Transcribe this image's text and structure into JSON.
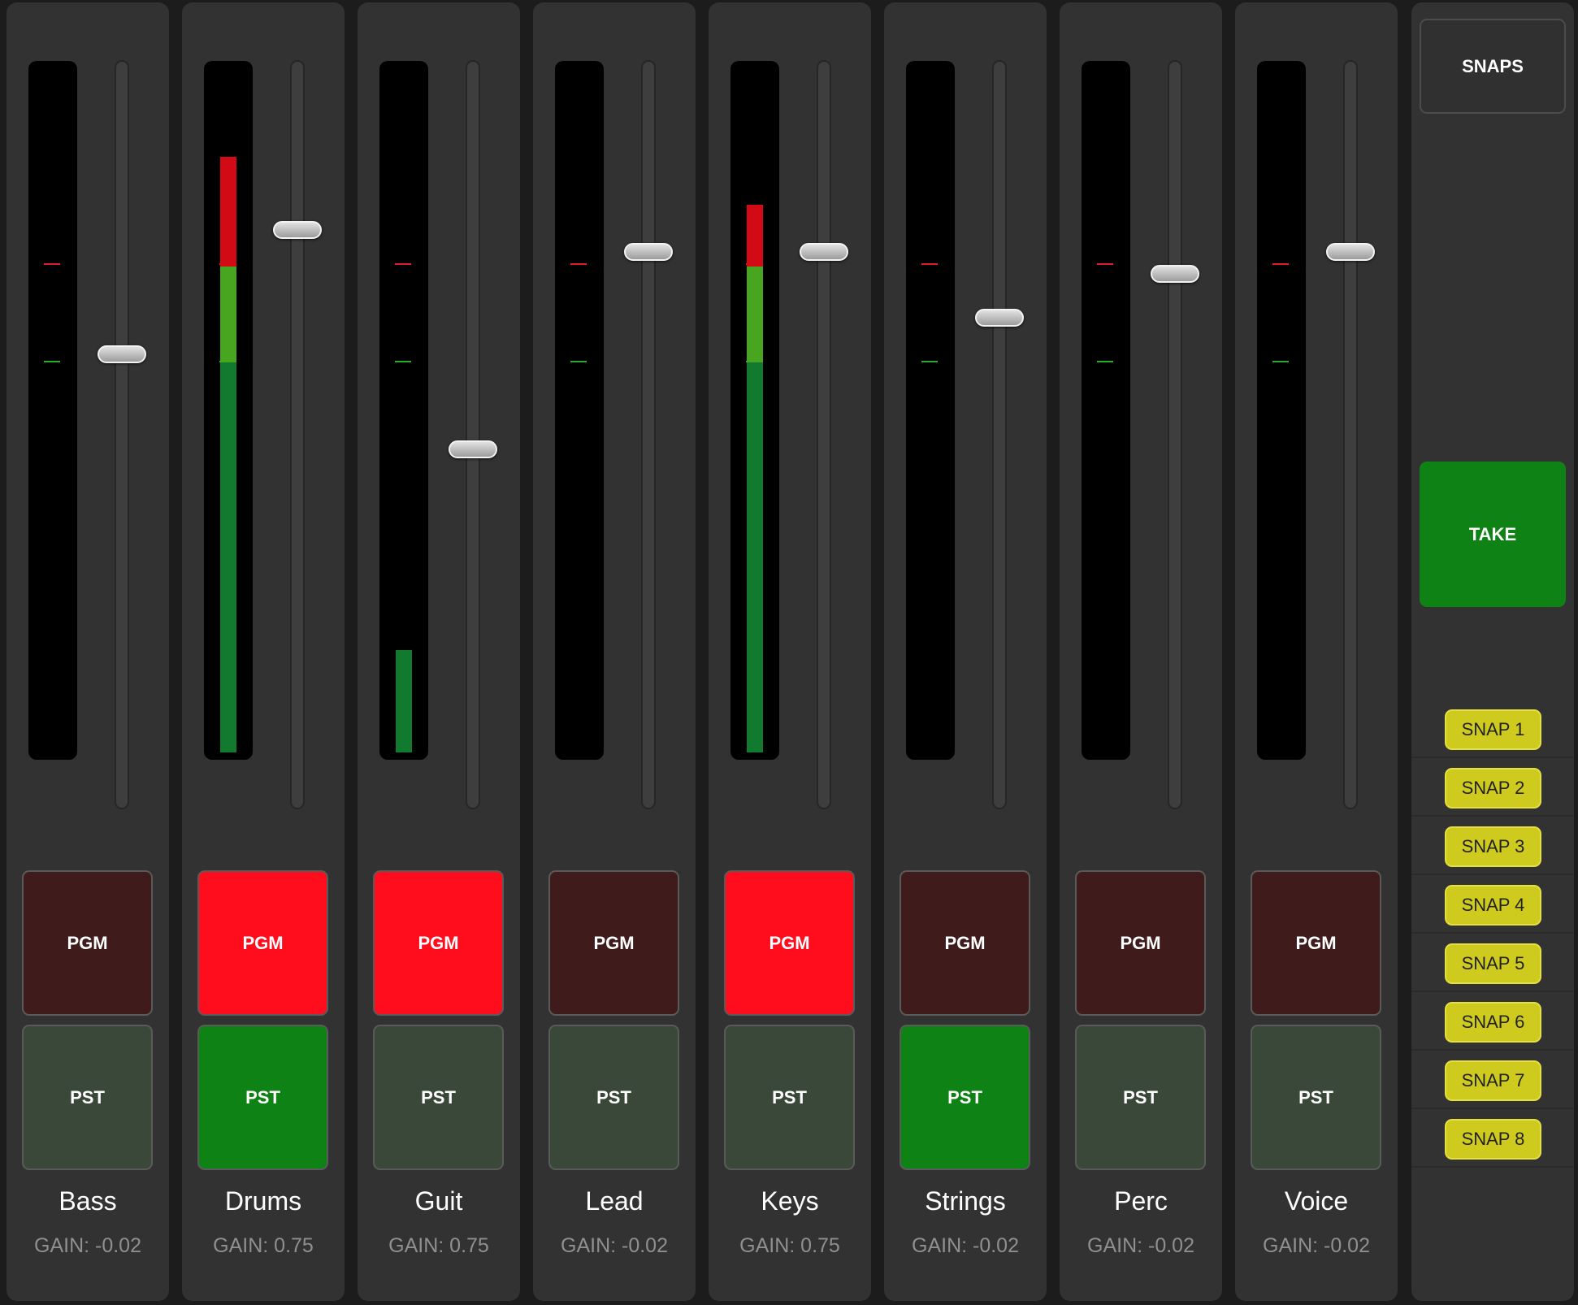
{
  "colors": {
    "pgm_on": "#ff0d1d",
    "pgm_off": "#3f1b1c",
    "pst_on": "#0f8215",
    "pst_off": "#394839",
    "meter_low": "#117a2e",
    "meter_mid": "#47a520",
    "meter_high": "#d20a16",
    "snap_button": "#cfcb1e",
    "take_button": "#0f8215"
  },
  "channels": [
    {
      "name": "Bass",
      "gain_text": "GAIN: -0.02",
      "pgm_label": "PGM",
      "pst_label": "PST",
      "pgm_active": false,
      "pst_active": false,
      "meter_level": 0.0,
      "fader_level": 0.61
    },
    {
      "name": "Drums",
      "gain_text": "GAIN: 0.75",
      "pgm_label": "PGM",
      "pst_label": "PST",
      "pgm_active": true,
      "pst_active": true,
      "meter_level": 0.87,
      "fader_level": 0.78
    },
    {
      "name": "Guit",
      "gain_text": "GAIN: 0.75",
      "pgm_label": "PGM",
      "pst_label": "PST",
      "pgm_active": true,
      "pst_active": false,
      "meter_level": 0.15,
      "fader_level": 0.48
    },
    {
      "name": "Lead",
      "gain_text": "GAIN: -0.02",
      "pgm_label": "PGM",
      "pst_label": "PST",
      "pgm_active": false,
      "pst_active": false,
      "meter_level": 0.0,
      "fader_level": 0.75
    },
    {
      "name": "Keys",
      "gain_text": "GAIN: 0.75",
      "pgm_label": "PGM",
      "pst_label": "PST",
      "pgm_active": true,
      "pst_active": false,
      "meter_level": 0.8,
      "fader_level": 0.75
    },
    {
      "name": "Strings",
      "gain_text": "GAIN: -0.02",
      "pgm_label": "PGM",
      "pst_label": "PST",
      "pgm_active": false,
      "pst_active": true,
      "meter_level": 0.0,
      "fader_level": 0.66
    },
    {
      "name": "Perc",
      "gain_text": "GAIN: -0.02",
      "pgm_label": "PGM",
      "pst_label": "PST",
      "pgm_active": false,
      "pst_active": false,
      "meter_level": 0.0,
      "fader_level": 0.72
    },
    {
      "name": "Voice",
      "gain_text": "GAIN: -0.02",
      "pgm_label": "PGM",
      "pst_label": "PST",
      "pgm_active": false,
      "pst_active": false,
      "meter_level": 0.0,
      "fader_level": 0.75
    }
  ],
  "snaps_panel": {
    "header": "SNAPS",
    "take_label": "TAKE",
    "snaps": [
      "SNAP 1",
      "SNAP 2",
      "SNAP 3",
      "SNAP 4",
      "SNAP 5",
      "SNAP 6",
      "SNAP 7",
      "SNAP 8"
    ]
  }
}
